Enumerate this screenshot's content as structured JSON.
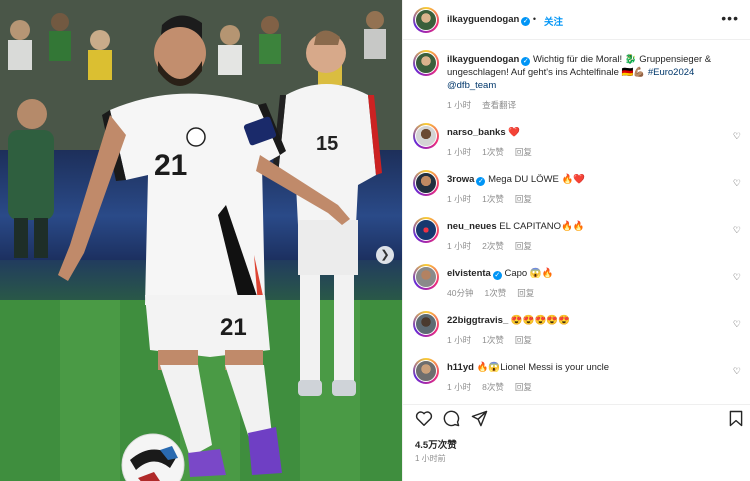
{
  "post": {
    "username": "ilkayguendogan",
    "follow_label": "关注",
    "more_label": "•••"
  },
  "caption": {
    "username": "ilkayguendogan",
    "text_part1": " Wichtig für die Moral! 🐉 Gruppensieger & ungeschlagen! Auf geht's ins Achtelfinale 🇩🇪💪🏽 ",
    "hashtag": "#Euro2024",
    "mention": "@dfb_team",
    "time": "1 小时",
    "translate": "查看翻译"
  },
  "comments": [
    {
      "username": "narso_banks",
      "verified": false,
      "text": "❤️",
      "time": "1 小时",
      "likes": "1次赞",
      "reply": "回复"
    },
    {
      "username": "3rowa",
      "verified": true,
      "text": "Mega DU LÖWE 🔥❤️",
      "time": "1 小时",
      "likes": "1次赞",
      "reply": "回复"
    },
    {
      "username": "neu_neues",
      "verified": false,
      "text": "EL CAPITANO🔥🔥",
      "time": "1 小时",
      "likes": "2次赞",
      "reply": "回复"
    },
    {
      "username": "elvistenta",
      "verified": true,
      "text": "Capo 😱🔥",
      "time": "40分钟",
      "likes": "1次赞",
      "reply": "回复"
    },
    {
      "username": "22biggtravis_",
      "verified": false,
      "text": "😍😍😍😍😍",
      "time": "1 小时",
      "likes": "1次赞",
      "reply": "回复"
    },
    {
      "username": "h11yd",
      "verified": false,
      "text": "🔥😱Lionel Messi is your uncle",
      "time": "1 小时",
      "likes": "8次赞",
      "reply": "回复"
    }
  ],
  "footer": {
    "likes": "4.5万次赞",
    "time": "1 小时前"
  },
  "photo": {
    "jersey_front": "21",
    "jersey_back": "15"
  },
  "icons": {
    "like": "heart-icon",
    "comment": "comment-icon",
    "share": "share-icon",
    "save": "bookmark-icon"
  },
  "colors": {
    "accent": "#0095f6",
    "heart": "#e0245e"
  }
}
